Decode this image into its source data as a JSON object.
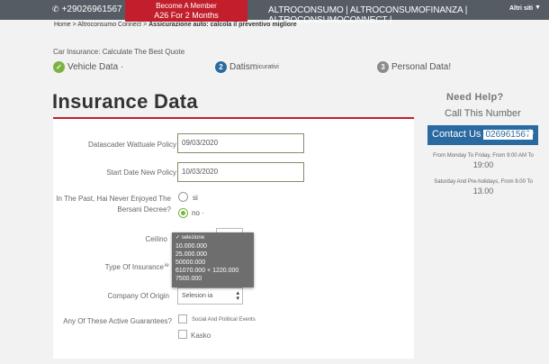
{
  "topbar": {
    "phone": "+29026961567",
    "promo_line1": "Become A Member",
    "promo_line2": "A26 For 2 Months",
    "sites": "ALTROCONSUMO | ALTROCONSUMOFINANZA | ALTROCONSUMOCONNECT |",
    "altri": "Altri siti"
  },
  "breadcrumb": {
    "home": "Home",
    "sep1": ">",
    "connect": "Altroconsumo Connect",
    "sep2": ">",
    "current": "Assicurazione auto: calcola il preventivo migliore"
  },
  "steps": {
    "heading": "Car Insurance: Calculate The Best Quote",
    "step1": {
      "label": "Vehicle Data",
      "suffix": "·"
    },
    "step2": {
      "num": "2",
      "label": "Datism",
      "small": "icurativi"
    },
    "step3": {
      "num": "3",
      "label": "Personal Data!"
    }
  },
  "page_title": "Insurance Data",
  "form": {
    "expiry_label": "Datascader Wattuale Policy",
    "expiry_value": "09/03/2020",
    "start_label": "Start Date New Policy",
    "start_value": "10/03/2020",
    "bersani_label_1": "In The Past, Hai Never Enjoyed The",
    "bersani_label_2": "Bersani Decree?",
    "yes_label": "si",
    "no_label": "no",
    "no_suffix": "·",
    "ceiling_label": "Ceilino",
    "type_label": "Type Of Insurance",
    "type_suffix": "ie",
    "origin_label": "Company Of Origin",
    "origin_value": "Selesion",
    "origin_value_suffix": "ia",
    "guarantees_label": "Any Of These Active Guarantees?",
    "guarantee1": "Social And Political Events",
    "guarantee2": "Kasko"
  },
  "dropdown": {
    "options": [
      "✓ selezione",
      "10.000.000",
      "25.000.000",
      "50000.000",
      "61070.000 + 1220.000",
      "7500.000"
    ]
  },
  "help": {
    "title": "Need Help?",
    "sub": "Call This Number",
    "contact_label": "Contact Us",
    "contact_number": "026961567",
    "weekday_hours": "From Monday To Friday, From 9:00 AM To",
    "weekday_end": "19:00",
    "weekend_hours": "Saturday And Pre-holidays, From 9.00 To",
    "weekend_end": "13.00"
  },
  "colors": {
    "accent_red": "#c21e2b",
    "accent_blue": "#2b6aa0",
    "accent_green": "#7bb343",
    "topbar": "#555c63"
  },
  "icons": {
    "phone": "phone-icon",
    "check": "check-icon",
    "chevron": "chevron-down-icon"
  }
}
